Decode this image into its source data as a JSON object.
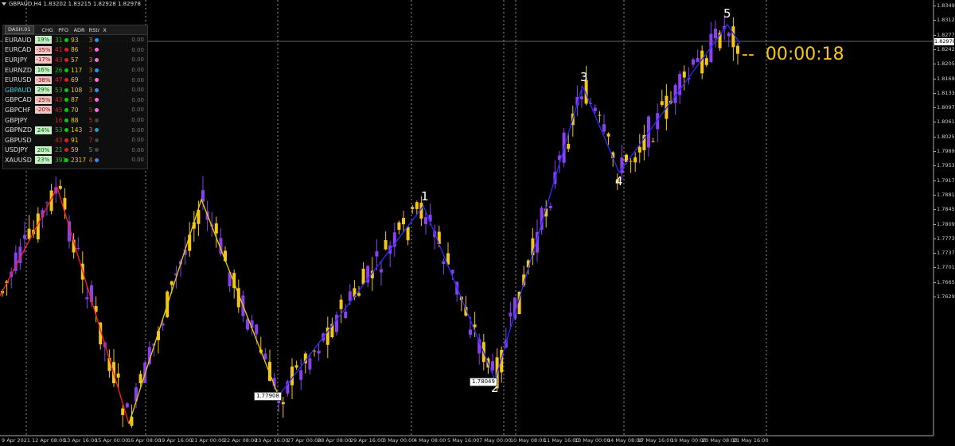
{
  "title_bar": "GBPAUD,H4  1.83202 1.83215 1.82928 1.82978",
  "current_price": "1.82978",
  "timer": "--  00:00:18",
  "price_axis": [
    "1.83490",
    "1.83125",
    "1.82775",
    "1.82425",
    "1.82055",
    "1.81695",
    "1.81335",
    "1.80975",
    "1.80615",
    "1.80255",
    "1.79895",
    "1.79535",
    "1.79175",
    "1.78815",
    "1.78455",
    "1.78095",
    "1.77735",
    "1.77375",
    "1.77015",
    "1.76655",
    "1.76295"
  ],
  "time_axis": [
    "9 Apr 2021",
    "12 Apr 08:00",
    "13 Apr 16:00",
    "15 Apr 00:00",
    "16 Apr 08:00",
    "19 Apr 16:00",
    "21 Apr 00:00",
    "22 Apr 08:00",
    "23 Apr 16:00",
    "27 Apr 00:00",
    "28 Apr 08:00",
    "29 Apr 16:00",
    "3 May 00:00",
    "4 May 08:00",
    "5 May 16:00",
    "7 May 00:00",
    "10 May 08:00",
    "11 May 16:00",
    "13 May 00:00",
    "14 May 08:00",
    "17 May 16:00",
    "19 May 00:00",
    "20 May 08:00",
    "21 May 16:00"
  ],
  "wave_labels": [
    "1",
    "2",
    "3",
    "4",
    "5"
  ],
  "box_labels": [
    "1.77908",
    "1.78049"
  ],
  "dashboard": {
    "tab": "DASH.01",
    "headers": [
      "CHG",
      "PFO",
      "ADR",
      "RStr",
      "X"
    ],
    "rows": [
      {
        "sym": "EURAUD",
        "chg": "19%",
        "pfo": "31",
        "adr": "93",
        "rstr": "3",
        "val": "0.00",
        "chg_color": "pos",
        "pfo_color": "#00d000",
        "dot": "#00d000",
        "rcolor": "#e08000",
        "d2": "#2196f3"
      },
      {
        "sym": "EURCAD",
        "chg": "-35%",
        "pfo": "41",
        "adr": "86",
        "rstr": "5",
        "val": "0.00",
        "chg_color": "neg",
        "pfo_color": "#e02020",
        "dot": "#e02020",
        "rcolor": "#e02020",
        "d2": "#ff6ee0"
      },
      {
        "sym": "EURJPY",
        "chg": "-17%",
        "pfo": "43",
        "adr": "57",
        "rstr": "3",
        "val": "0.00",
        "chg_color": "neg",
        "pfo_color": "#e02020",
        "dot": "#e02020",
        "rcolor": "#e08000",
        "d2": "#ff6ee0"
      },
      {
        "sym": "EURNZD",
        "chg": "16%",
        "pfo": "26",
        "adr": "117",
        "rstr": "3",
        "val": "0.00",
        "chg_color": "pos",
        "pfo_color": "#00d000",
        "dot": "#00d000",
        "rcolor": "#e08000",
        "d2": "#2196f3"
      },
      {
        "sym": "EURUSD",
        "chg": "-38%",
        "pfo": "47",
        "adr": "69",
        "rstr": "5",
        "val": "0.00",
        "chg_color": "neg",
        "pfo_color": "#e02020",
        "dot": "#e02020",
        "rcolor": "#e02020",
        "d2": "#ff6ee0"
      },
      {
        "sym": "GBPAUD",
        "chg": "29%",
        "pfo": "53",
        "adr": "108",
        "rstr": "3",
        "val": "0.00",
        "chg_color": "pos",
        "pfo_color": "#00d000",
        "dot": "#00d000",
        "rcolor": "#e08000",
        "d2": "#2196f3",
        "active": true
      },
      {
        "sym": "GBPCAD",
        "chg": "-25%",
        "pfo": "43",
        "adr": "87",
        "rstr": "5",
        "val": "0.00",
        "chg_color": "neg",
        "pfo_color": "#e02020",
        "dot": "#00d000",
        "rcolor": "#e02020",
        "d2": "#ff6ee0"
      },
      {
        "sym": "GBPCHF",
        "chg": "-20%",
        "pfo": "45",
        "adr": "70",
        "rstr": "5",
        "val": "0.00",
        "chg_color": "neg",
        "pfo_color": "#e02020",
        "dot": "#00d000",
        "rcolor": "#e02020",
        "d2": "#ff6ee0"
      },
      {
        "sym": "GBPJPY",
        "chg": "",
        "pfo": "16",
        "adr": "88",
        "rstr": "5",
        "val": "0.00",
        "chg_color": "none",
        "pfo_color": "#e02020",
        "dot": "#00d000",
        "rcolor": "#e02020",
        "d2": "#444444"
      },
      {
        "sym": "GBPNZD",
        "chg": "24%",
        "pfo": "53",
        "adr": "143",
        "rstr": "3",
        "val": "0.00",
        "chg_color": "pos",
        "pfo_color": "#00d000",
        "dot": "#00d000",
        "rcolor": "#e08000",
        "d2": "#2196f3"
      },
      {
        "sym": "GBPUSD",
        "chg": "",
        "pfo": "43",
        "adr": "91",
        "rstr": "7",
        "val": "0.00",
        "chg_color": "none",
        "pfo_color": "#e02020",
        "dot": "#e02020",
        "rcolor": "#e02020",
        "d2": "#444444"
      },
      {
        "sym": "USDJPY",
        "chg": "20%",
        "pfo": "21",
        "adr": "59",
        "rstr": "5",
        "val": "0.00",
        "chg_color": "pos",
        "pfo_color": "#00d000",
        "dot": "#e02020",
        "rcolor": "#00d000",
        "d2": "#444444"
      },
      {
        "sym": "XAUUSD",
        "chg": "23%",
        "pfo": "391",
        "adr": "2317",
        "rstr": "4",
        "val": "0.00",
        "chg_color": "pos",
        "pfo_color": "#00d000",
        "dot": "#00d000",
        "rcolor": "#e08000",
        "d2": "#2196f3"
      }
    ]
  },
  "colors": {
    "bull_candle": "#8a3ff0",
    "bear_candle": "#f5c518",
    "wave_line": "#2b2bff",
    "down_line": "#ff2020",
    "up_line": "#e8d000",
    "grid": "#ffffff",
    "chg_pos_bg": "#c8f0c8",
    "chg_neg_bg": "#f0c8c8"
  }
}
